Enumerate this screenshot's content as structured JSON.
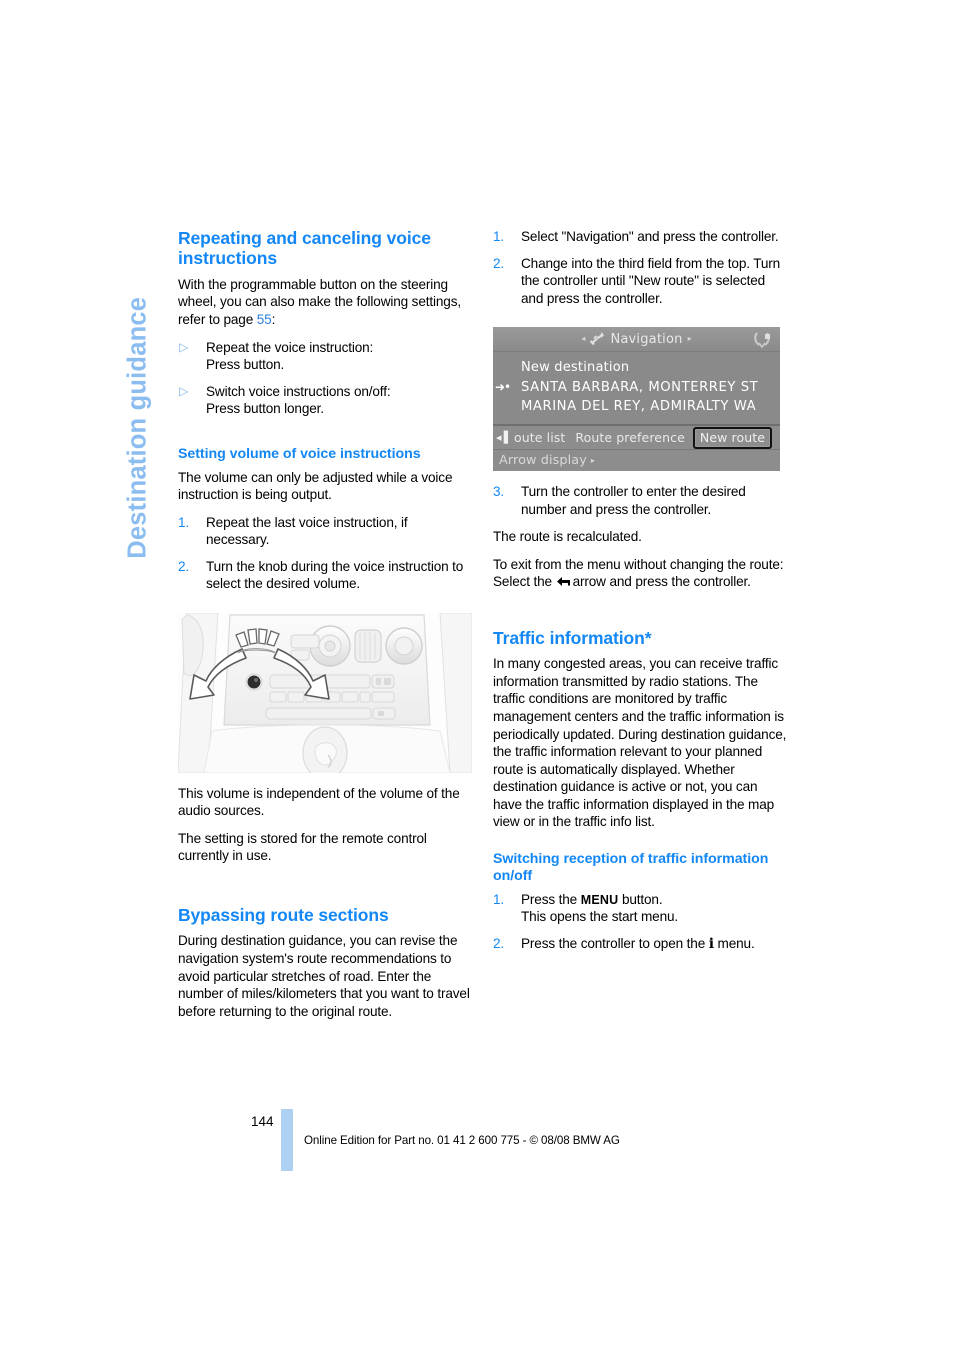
{
  "chapter": {
    "tab_label": "Destination guidance"
  },
  "left_column": {
    "section1": {
      "title": "Repeating and canceling voice instructions",
      "intro_before_ref": "With the programmable button on the steering wheel, you can also make the following settings, refer to page ",
      "page_ref": "55",
      "intro_after_ref": ":",
      "bullets": [
        {
          "mark": "▷",
          "line1": "Repeat the voice instruction:",
          "line2": "Press button."
        },
        {
          "mark": "▷",
          "line1": "Switch voice instructions on/off:",
          "line2": "Press button longer."
        }
      ]
    },
    "section2": {
      "title": "Setting volume of voice instructions",
      "paragraph": "The volume can only be adjusted while a voice instruction is being output.",
      "steps": [
        {
          "num": "1.",
          "text": "Repeat the last voice instruction, if necessary."
        },
        {
          "num": "2.",
          "text": "Turn the knob during the voice instruction to select the desired volume."
        }
      ],
      "figure": {
        "name": "center-console-volume-knob",
        "credit": ""
      },
      "after_figure": [
        "This volume is independent of the volume of the audio sources.",
        "The setting is stored for the remote control currently in use."
      ]
    },
    "section3": {
      "title": "Bypassing route sections",
      "paragraph": "During destination guidance, you can revise the navigation system's route recommendations to avoid particular stretches of road. Enter the number of miles/kilometers that you want to travel before returning to the original route."
    }
  },
  "right_column": {
    "steps_top": [
      {
        "num": "1.",
        "text": "Select \"Navigation\" and press the controller."
      },
      {
        "num": "2.",
        "text": "Change into the third field from the top. Turn the controller until \"New route\" is selected and press the controller."
      }
    ],
    "nav_screen": {
      "header_title": "Navigation",
      "header_left_arrow": "◂",
      "header_right_arrow": "▸",
      "header_icon": "navigation-crosshair-icon",
      "compass_icon": "compass-icon",
      "rows": [
        {
          "gutter": "",
          "text": "New destination",
          "style": "dest"
        },
        {
          "gutter": "➜•",
          "text": "SANTA BARBARA, MONTERREY ST",
          "style": "addr"
        },
        {
          "gutter": "",
          "text": "MARINA DEL REY, ADMIRALTY WA",
          "style": "addr"
        }
      ],
      "tabs": {
        "back_arrow": "◂▐",
        "items": [
          {
            "label": "oute list",
            "selected": false
          },
          {
            "label": "Route preference",
            "selected": false
          },
          {
            "label": "New route",
            "selected": true
          }
        ]
      },
      "footer_label": "Arrow display",
      "footer_caret": "▸",
      "credit": ""
    },
    "steps_after": [
      {
        "num": "3.",
        "text": "Turn the controller to enter the desired number and press the controller."
      }
    ],
    "paragraphs_after": [
      "The route is recalculated."
    ],
    "exit_note": {
      "line1": "To exit from the menu without changing the route:",
      "select_prefix": "Select the ",
      "arrow_icon": "back-arrow-icon",
      "select_suffix": "arrow and press the controller."
    },
    "section_traffic": {
      "title": "Traffic information*",
      "paragraph": "In many congested areas, you can receive traffic information transmitted by radio stations. The traffic conditions are monitored by traffic management centers and the traffic information is periodically updated. During destination guidance, the traffic information relevant to your planned route is automatically displayed. Whether destination guidance is active or not, you can have the traffic information displayed in the map view or in the traffic info list."
    },
    "section_switching": {
      "title": "Switching reception of traffic information on/off",
      "steps": [
        {
          "num": "1.",
          "prefix": "Press the ",
          "glyph": "MENU",
          "suffix": " button.",
          "line2": "This opens the start menu."
        },
        {
          "num": "2.",
          "prefix": "Press the controller to open the ",
          "glyph": "i",
          "suffix": " menu.",
          "line2": ""
        }
      ]
    }
  },
  "footer": {
    "page_number": "144",
    "imprint": "Online Edition for Part no. 01 41 2 600 775 - © 08/08 BMW AG"
  }
}
